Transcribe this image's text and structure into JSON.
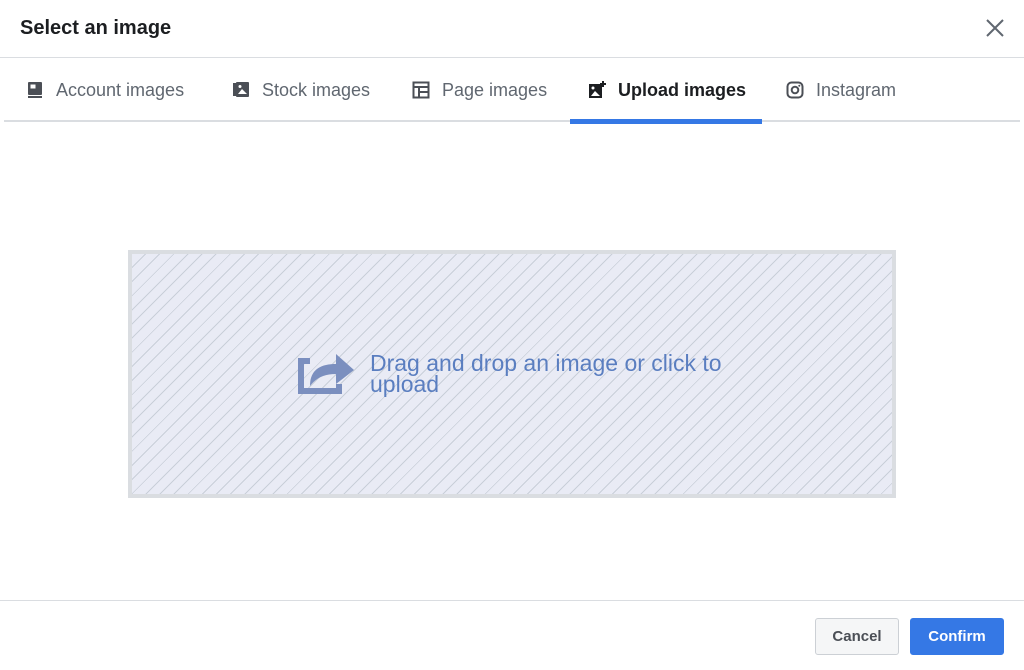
{
  "dialog": {
    "title": "Select an image",
    "close_icon": "close-icon"
  },
  "tabs": [
    {
      "label": "Account images",
      "icon": "account-images-icon",
      "active": false
    },
    {
      "label": "Stock images",
      "icon": "stock-images-icon",
      "active": false
    },
    {
      "label": "Page images",
      "icon": "page-images-icon",
      "active": false
    },
    {
      "label": "Upload images",
      "icon": "upload-images-icon",
      "active": true
    },
    {
      "label": "Instagram",
      "icon": "instagram-icon",
      "active": false
    }
  ],
  "dropzone": {
    "icon": "share-upload-icon",
    "text": "Drag and drop an image or click to upload"
  },
  "footer": {
    "cancel_label": "Cancel",
    "confirm_label": "Confirm"
  },
  "colors": {
    "accent": "#3578e5",
    "dropzone_text": "#5a7ec0",
    "dropzone_bg": "#e9ebf5"
  }
}
